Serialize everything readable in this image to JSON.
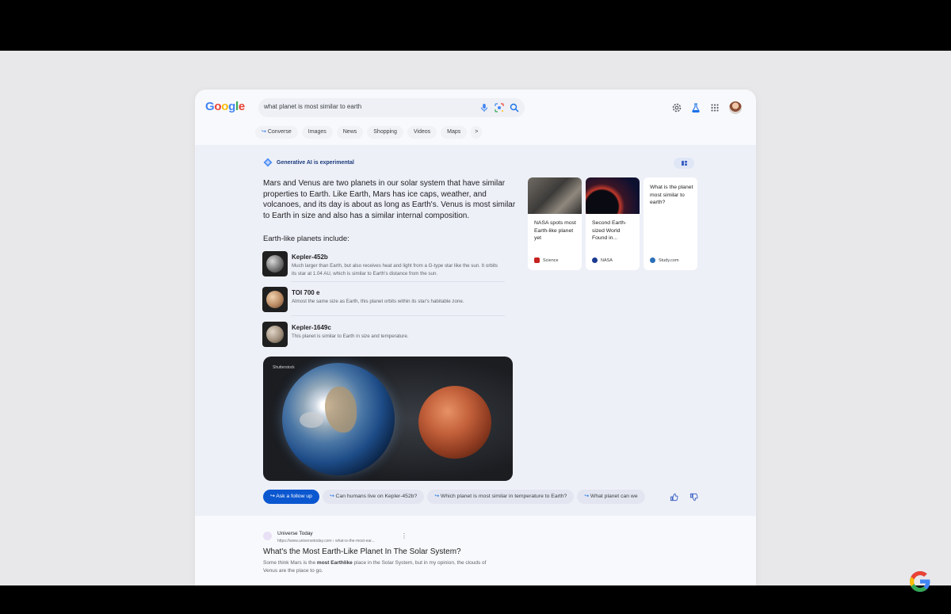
{
  "header": {
    "logo_letters": [
      {
        "ch": "G",
        "color": "#4285F4"
      },
      {
        "ch": "o",
        "color": "#EA4335"
      },
      {
        "ch": "o",
        "color": "#FBBC05"
      },
      {
        "ch": "g",
        "color": "#4285F4"
      },
      {
        "ch": "l",
        "color": "#34A853"
      },
      {
        "ch": "e",
        "color": "#EA4335"
      }
    ],
    "search_query": "what planet is most similar to earth",
    "search_icons": [
      "microphone-icon",
      "lens-icon",
      "search-icon"
    ],
    "right_icons": [
      "gear-icon",
      "labs-flask-icon",
      "apps-grid-icon"
    ]
  },
  "tabs": [
    {
      "label": "Converse",
      "icon": "follow-arrow-icon"
    },
    {
      "label": "Images"
    },
    {
      "label": "News"
    },
    {
      "label": "Shopping"
    },
    {
      "label": "Videos"
    },
    {
      "label": "Maps"
    },
    {
      "label": ">"
    }
  ],
  "ai": {
    "badge": "Generative AI is experimental",
    "summary": "Mars and Venus are two planets in our solar system that have similar properties to Earth. Like Earth, Mars has ice caps, weather, and volcanoes, and its day is about as long as Earth's. Venus is most similar to Earth in size and also has a similar internal composition.",
    "planets_heading": "Earth-like planets include:",
    "planets": [
      {
        "name": "Kepler-452b",
        "desc": "Much larger than Earth, but also receives heat and light from a G-type star like the sun. It orbits its star at 1.04 AU, which is similar to Earth's distance from the sun."
      },
      {
        "name": "TOI 700 e",
        "desc": "Almost the same size as Earth, this planet orbits within its star's habitable zone."
      },
      {
        "name": "Kepler-1649c",
        "desc": "This planet is similar to Earth in size and temperature."
      }
    ],
    "image_credit": "Shutterstock",
    "cards": [
      {
        "title": "NASA spots most Earth-like planet yet",
        "source": "Science",
        "source_color": "#c5221f"
      },
      {
        "title": "Second Earth-sized World Found in...",
        "source": "NASA",
        "source_color": "#1a3b8f"
      },
      {
        "title": "What is the planet most similar to earth?",
        "source": "Study.com",
        "source_color": "#2b6fb8"
      }
    ]
  },
  "followups": [
    "Ask a follow up",
    "Can humans live on Kepler-452b?",
    "Which planet is most similar in temperature to Earth?",
    "What planet can we"
  ],
  "result": {
    "site": "Universe Today",
    "url": "https://www.universetoday.com › what-is-the-most-ear...",
    "more": "⋮",
    "title": "What's the Most Earth-Like Planet In The Solar System?",
    "snippet_pre": "Some think Mars is the ",
    "snippet_bold": "most Earthlike",
    "snippet_post": " place in the Solar System, but in my opinion, the clouds of Venus are the place to go."
  }
}
